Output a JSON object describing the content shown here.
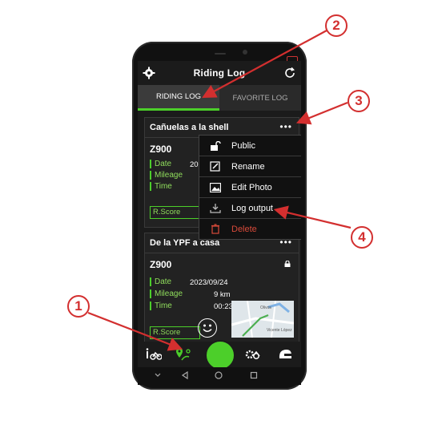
{
  "header": {
    "title": "Riding Log"
  },
  "tabs": [
    {
      "label": "RIDING LOG",
      "active": true
    },
    {
      "label": "FAVORITE LOG",
      "active": false
    }
  ],
  "logs": [
    {
      "name": "Cañuelas a la shell",
      "more": "•••",
      "model": "Z900",
      "fields": {
        "date_label": "Date",
        "date": "2023",
        "mileage_label": "Mileage",
        "time_label": "Time"
      },
      "rscore_label": "R.Score"
    },
    {
      "name": "De la YPF a casa",
      "more": "•••",
      "model": "Z900",
      "fields": {
        "date_label": "Date",
        "date": "2023/09/24",
        "mileage_label": "Mileage",
        "mileage": "9 km",
        "time_label": "Time",
        "time": "00:23"
      },
      "rscore_label": "R.Score",
      "map_labels": [
        "Olivos",
        "Vicente López"
      ]
    }
  ],
  "context_menu": [
    {
      "label": "Public",
      "icon": "unlock-icon"
    },
    {
      "label": "Rename",
      "icon": "rename-icon"
    },
    {
      "label": "Edit Photo",
      "icon": "photo-icon"
    },
    {
      "label": "Log output",
      "icon": "export-icon"
    },
    {
      "label": "Delete",
      "icon": "trash-icon"
    }
  ],
  "callouts": [
    "1",
    "2",
    "3",
    "4"
  ],
  "colors": {
    "accent": "#4ccf2a",
    "callout": "#d32f2f",
    "delete": "#d84a3a"
  }
}
